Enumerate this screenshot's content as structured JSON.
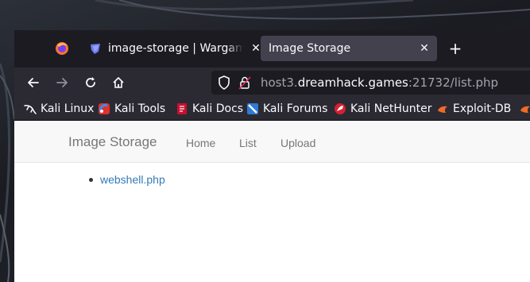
{
  "tabs": [
    {
      "title": "image-storage | Wargame",
      "icon": "dreamhack-icon",
      "close": "✕"
    },
    {
      "title": "Image Storage",
      "close": "✕",
      "active": true
    }
  ],
  "new_tab": "+",
  "url": {
    "pre": "host3.",
    "domain": "dreamhack.games",
    "post": ":21732/list.php"
  },
  "bookmarks": [
    {
      "label": "Kali Linux",
      "icon": "kali-dragon-icon"
    },
    {
      "label": "Kali Tools",
      "icon": "kali-tools-icon"
    },
    {
      "label": "Kali Docs",
      "icon": "kali-docs-icon"
    },
    {
      "label": "Kali Forums",
      "icon": "kali-forums-icon"
    },
    {
      "label": "Kali NetHunter",
      "icon": "nethunter-icon"
    },
    {
      "label": "Exploit-DB",
      "icon": "exploitdb-icon"
    }
  ],
  "site": {
    "brand": "Image Storage",
    "nav": [
      "Home",
      "List",
      "Upload"
    ],
    "files": [
      "webshell.php"
    ]
  },
  "colors": {
    "tabbar": "#1c1b22",
    "toolbar": "#2b2a33",
    "link": "#337ab7",
    "navbar_bg": "#f8f8f8"
  }
}
